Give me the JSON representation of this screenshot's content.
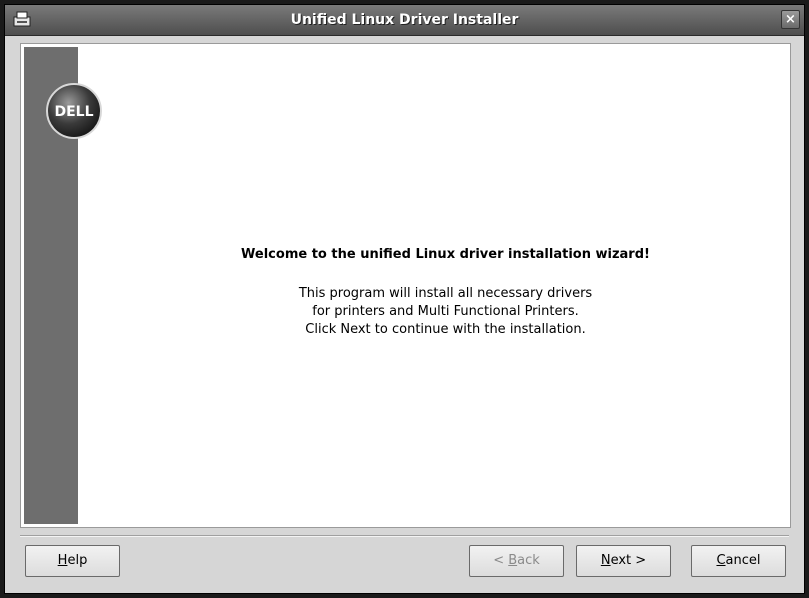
{
  "window": {
    "title": "Unified Linux Driver Installer",
    "close_glyph": "×"
  },
  "branding": {
    "logo_text": "DELL"
  },
  "main": {
    "welcome": "Welcome to the unified Linux driver installation wizard!",
    "description_lines": [
      "This program will install all necessary drivers",
      "for printers and Multi Functional Printers.",
      "Click Next to continue with the installation."
    ]
  },
  "buttons": {
    "help": {
      "mnemonic": "H",
      "rest": "elp"
    },
    "back": {
      "prefix": "< ",
      "mnemonic": "B",
      "rest": "ack"
    },
    "next": {
      "mnemonic": "N",
      "rest": "ext >"
    },
    "cancel": {
      "mnemonic": "C",
      "rest": "ancel"
    }
  },
  "colors": {
    "titlebar": "#5c5c5c",
    "sidebar": "#6e6e6e",
    "window_bg": "#d6d6d6"
  },
  "icons": {
    "app": "installer-icon",
    "close": "close-icon",
    "logo": "dell-logo"
  }
}
